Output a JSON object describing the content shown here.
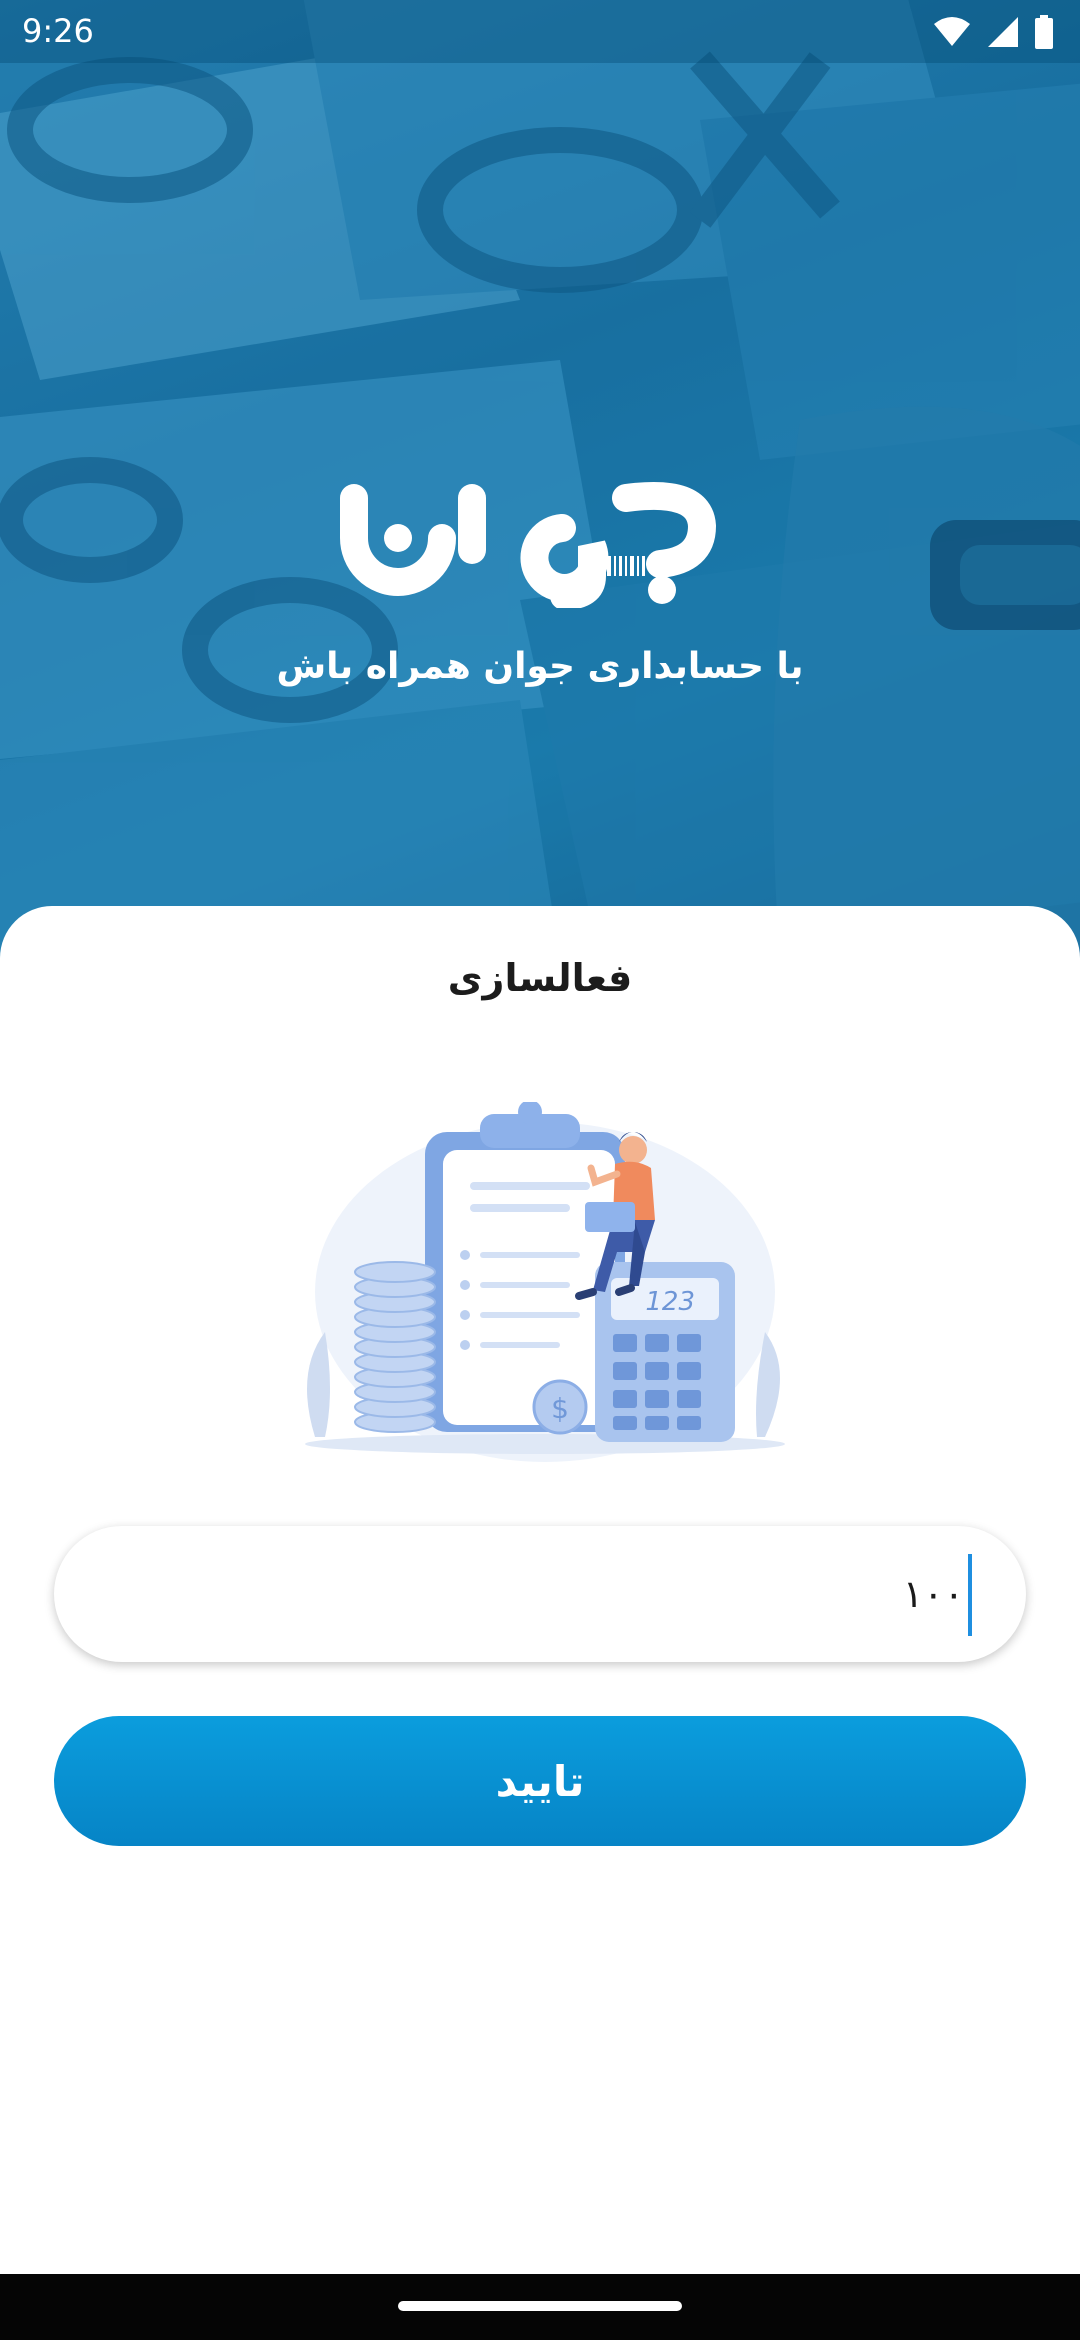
{
  "status_bar": {
    "time": "9:26",
    "icons": [
      "wifi-icon",
      "cellular-signal-icon",
      "battery-icon"
    ]
  },
  "brand": {
    "logo_text": "جوان",
    "tagline": "با حسابداری جوان همراه باش"
  },
  "activation": {
    "title": "فعالسازی",
    "illustration": "accounting-illustration",
    "code_value": "۱۰۰",
    "confirm_label": "تایید"
  },
  "colors": {
    "accent": "#0a93d6",
    "caret": "#1f8fe0",
    "hero": "#1b6f9f",
    "nav_bar": "#050505"
  }
}
